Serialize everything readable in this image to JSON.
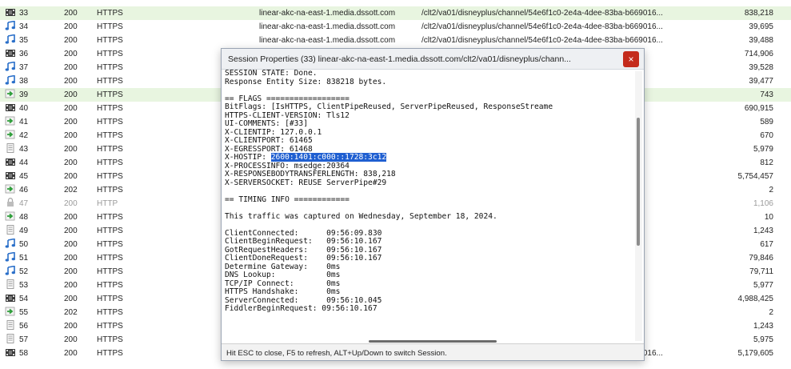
{
  "sessions": [
    {
      "num": "33",
      "result": "200",
      "protocol": "HTTPS",
      "host": "linear-akc-na-east-1.media.dssott.com",
      "url": "/clt2/va01/disneyplus/channel/54e6f1c0-2e4a-4dee-83ba-b669016...",
      "body": "838,218",
      "icon": "video-icon",
      "highlight": true,
      "dim": false
    },
    {
      "num": "34",
      "result": "200",
      "protocol": "HTTPS",
      "host": "linear-akc-na-east-1.media.dssott.com",
      "url": "/clt2/va01/disneyplus/channel/54e6f1c0-2e4a-4dee-83ba-b669016...",
      "body": "39,695",
      "icon": "audio-icon",
      "highlight": false,
      "dim": false
    },
    {
      "num": "35",
      "result": "200",
      "protocol": "HTTPS",
      "host": "linear-akc-na-east-1.media.dssott.com",
      "url": "/clt2/va01/disneyplus/channel/54e6f1c0-2e4a-4dee-83ba-b669016...",
      "body": "39,488",
      "icon": "audio-icon",
      "highlight": false,
      "dim": false
    },
    {
      "num": "36",
      "result": "200",
      "protocol": "HTTPS",
      "host": "",
      "url": "a-b669016...",
      "body": "714,906",
      "icon": "video-icon",
      "highlight": false,
      "dim": false
    },
    {
      "num": "37",
      "result": "200",
      "protocol": "HTTPS",
      "host": "",
      "url": "a-b669016...",
      "body": "39,528",
      "icon": "audio-icon",
      "highlight": false,
      "dim": false
    },
    {
      "num": "38",
      "result": "200",
      "protocol": "HTTPS",
      "host": "",
      "url": "a-b669016...",
      "body": "39,477",
      "icon": "audio-icon",
      "highlight": false,
      "dim": false
    },
    {
      "num": "39",
      "result": "200",
      "protocol": "HTTPS",
      "host": "",
      "url": "",
      "body": "743",
      "icon": "arrow-icon",
      "highlight": true,
      "dim": false
    },
    {
      "num": "40",
      "result": "200",
      "protocol": "HTTPS",
      "host": "",
      "url": "a-b669016...",
      "body": "690,915",
      "icon": "video-icon",
      "highlight": false,
      "dim": false
    },
    {
      "num": "41",
      "result": "200",
      "protocol": "HTTPS",
      "host": "",
      "url": "",
      "body": "589",
      "icon": "arrow-icon",
      "highlight": false,
      "dim": false
    },
    {
      "num": "42",
      "result": "200",
      "protocol": "HTTPS",
      "host": "",
      "url": "",
      "body": "670",
      "icon": "arrow-icon",
      "highlight": false,
      "dim": false
    },
    {
      "num": "43",
      "result": "200",
      "protocol": "HTTPS",
      "host": "",
      "url": "a-b669016...",
      "body": "5,979",
      "icon": "doc-icon",
      "highlight": false,
      "dim": false
    },
    {
      "num": "44",
      "result": "200",
      "protocol": "HTTPS",
      "host": "",
      "url": "a-b669016...",
      "body": "812",
      "icon": "video-icon",
      "highlight": false,
      "dim": false
    },
    {
      "num": "45",
      "result": "200",
      "protocol": "HTTPS",
      "host": "",
      "url": "a-b669016...",
      "body": "5,754,457",
      "icon": "video-icon",
      "highlight": false,
      "dim": false
    },
    {
      "num": "46",
      "result": "202",
      "protocol": "HTTPS",
      "host": "",
      "url": "",
      "body": "2",
      "icon": "arrow-icon",
      "highlight": false,
      "dim": false
    },
    {
      "num": "47",
      "result": "200",
      "protocol": "HTTP",
      "host": "",
      "url": "",
      "body": "1,106",
      "icon": "lock-icon",
      "highlight": false,
      "dim": true
    },
    {
      "num": "48",
      "result": "200",
      "protocol": "HTTPS",
      "host": "",
      "url": "",
      "body": "10",
      "icon": "arrow-icon",
      "highlight": false,
      "dim": false
    },
    {
      "num": "49",
      "result": "200",
      "protocol": "HTTPS",
      "host": "",
      "url": "a-b669016...",
      "body": "1,243",
      "icon": "doc-icon",
      "highlight": false,
      "dim": false
    },
    {
      "num": "50",
      "result": "200",
      "protocol": "HTTPS",
      "host": "",
      "url": "a-b669016...",
      "body": "617",
      "icon": "audio-icon",
      "highlight": false,
      "dim": false
    },
    {
      "num": "51",
      "result": "200",
      "protocol": "HTTPS",
      "host": "",
      "url": "a-b669016...",
      "body": "79,846",
      "icon": "audio-icon",
      "highlight": false,
      "dim": false
    },
    {
      "num": "52",
      "result": "200",
      "protocol": "HTTPS",
      "host": "",
      "url": "a-b669016...",
      "body": "79,711",
      "icon": "audio-icon",
      "highlight": false,
      "dim": false
    },
    {
      "num": "53",
      "result": "200",
      "protocol": "HTTPS",
      "host": "",
      "url": "a-b669016...",
      "body": "5,977",
      "icon": "doc-icon",
      "highlight": false,
      "dim": false
    },
    {
      "num": "54",
      "result": "200",
      "protocol": "HTTPS",
      "host": "",
      "url": "a-b669016...",
      "body": "4,988,425",
      "icon": "video-icon",
      "highlight": false,
      "dim": false
    },
    {
      "num": "55",
      "result": "202",
      "protocol": "HTTPS",
      "host": "",
      "url": "",
      "body": "2",
      "icon": "arrow-icon",
      "highlight": false,
      "dim": false
    },
    {
      "num": "56",
      "result": "200",
      "protocol": "HTTPS",
      "host": "",
      "url": "",
      "body": "1,243",
      "icon": "doc-icon",
      "highlight": false,
      "dim": false
    },
    {
      "num": "57",
      "result": "200",
      "protocol": "HTTPS",
      "host": "",
      "url": "a-b669016...",
      "body": "5,975",
      "icon": "doc-icon",
      "highlight": false,
      "dim": false
    },
    {
      "num": "58",
      "result": "200",
      "protocol": "HTTPS",
      "host": "linear-akc-na-east-1.media.dssott.com",
      "url": "/clt2/va01/disneyplus/channel/54e6f1c0-2e4a-4dee-83ba-b669016...",
      "body": "5,179,605",
      "icon": "video-icon",
      "highlight": false,
      "dim": false
    }
  ],
  "dialog": {
    "title": "Session Properties (33) linear-akc-na-east-1.media.dssott.com/clt2/va01/disneyplus/chann...",
    "close_glyph": "×",
    "lines": [
      "SESSION STATE: Done.",
      "Response Entity Size: 838218 bytes.",
      "",
      "== FLAGS ==================",
      "BitFlags: [IsHTTPS, ClientPipeReused, ServerPipeReused, ResponseStreame",
      "HTTPS-CLIENT-VERSION: Tls12",
      "UI-COMMENTS: [#33]",
      "X-CLIENTIP: 127.0.0.1",
      "X-CLIENTPORT: 61465",
      "X-EGRESSPORT: 61468",
      "X-HOSTIP: ",
      "X-PROCESSINFO: msedge:20364",
      "X-RESPONSEBODYTRANSFERLENGTH: 838,218",
      "X-SERVERSOCKET: REUSE ServerPipe#29",
      "",
      "== TIMING INFO ============",
      "",
      "This traffic was captured on Wednesday, September 18, 2024.",
      "",
      "ClientConnected:      09:56:09.830",
      "ClientBeginRequest:   09:56:10.167",
      "GotRequestHeaders:    09:56:10.167",
      "ClientDoneRequest:    09:56:10.167",
      "Determine Gateway:    0ms",
      "DNS Lookup:           0ms",
      "TCP/IP Connect:       0ms",
      "HTTPS Handshake:      0ms",
      "ServerConnected:      09:56:10.045",
      "FiddlerBeginRequest: 09:56:10.167"
    ],
    "selected_line_index": 10,
    "selected_text": "2600:1401:c000::1728:3c12",
    "status": "Hit ESC to close, F5 to refresh, ALT+Up/Down to switch Session."
  }
}
